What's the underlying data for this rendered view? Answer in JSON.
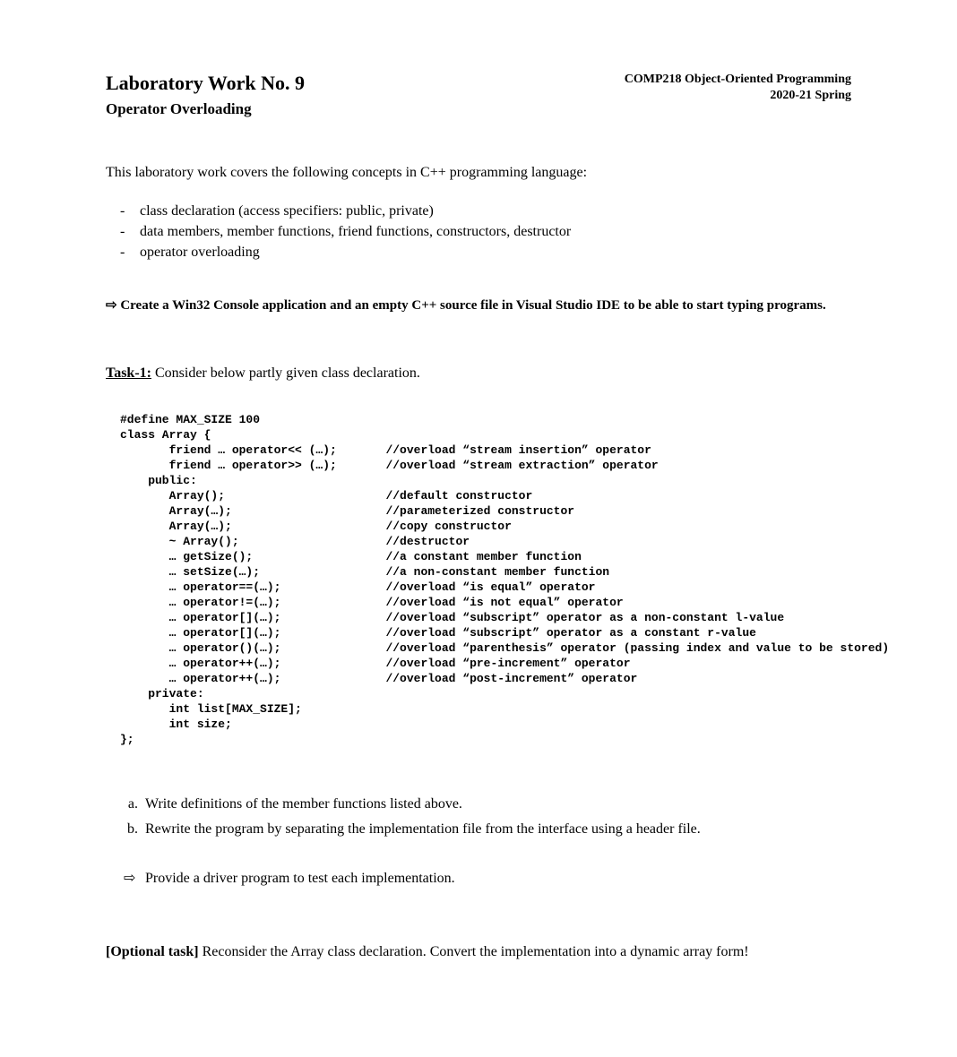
{
  "header": {
    "course": "COMP218 Object-Oriented Programming",
    "term": "2020-21 Spring"
  },
  "title": "Laboratory Work No. 9",
  "subtitle": "Operator Overloading",
  "intro": "This laboratory work covers the following concepts in C++ programming language:",
  "concepts": [
    "class declaration (access specifiers: public, private)",
    "data members, member functions, friend functions, constructors, destructor",
    "operator overloading"
  ],
  "instruction": "Create a Win32 Console application and an empty C++ source file in Visual Studio IDE to be able to start typing programs.",
  "task": {
    "label": "Task-1:",
    "text": " Consider below partly given class declaration."
  },
  "code": "#define MAX_SIZE 100\nclass Array {\n       friend … operator<< (…);       //overload “stream insertion” operator\n       friend … operator>> (…);       //overload “stream extraction” operator\n    public:\n       Array();                       //default constructor\n       Array(…);                      //parameterized constructor\n       Array(…);                      //copy constructor\n       ~ Array();                     //destructor\n       … getSize();                   //a constant member function\n       … setSize(…);                  //a non-constant member function\n       … operator==(…);               //overload “is equal” operator\n       … operator!=(…);               //overload “is not equal” operator\n       … operator[](…);               //overload “subscript” operator as a non-constant l-value\n       … operator[](…);               //overload “subscript” operator as a constant r-value\n       … operator()(…);               //overload “parenthesis” operator (passing index and value to be stored)\n       … operator++(…);               //overload “pre-increment” operator\n       … operator++(…);               //overload “post-increment” operator\n    private:\n       int list[MAX_SIZE];\n       int size;\n};",
  "subtasks": [
    "Write definitions of the member functions listed above.",
    "Rewrite the program by separating the implementation file from the interface using a header file."
  ],
  "driver": "Provide a driver program to test each implementation.",
  "optional": {
    "label": "[Optional task]",
    "text": " Reconsider the Array class declaration. Convert the implementation into a dynamic array form!"
  }
}
